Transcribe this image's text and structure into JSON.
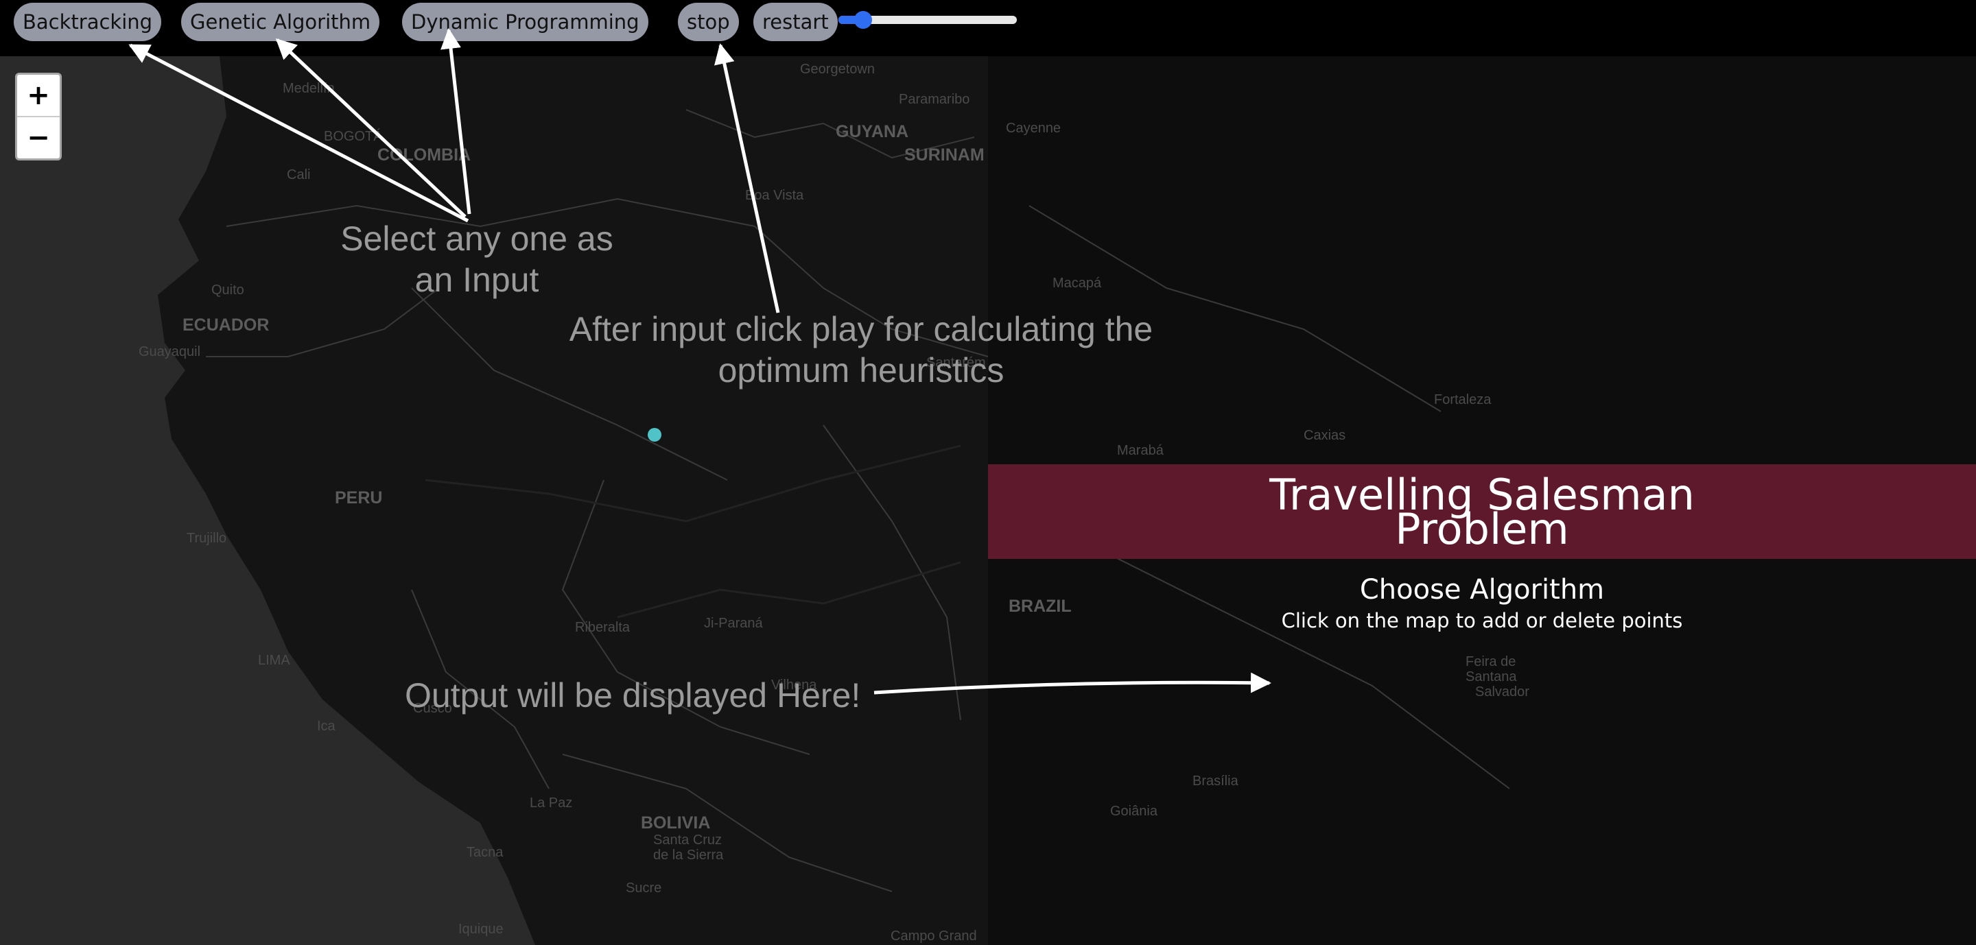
{
  "toolbar": {
    "buttons": {
      "backtracking": "Backtracking",
      "genetic": "Genetic Algorithm",
      "dynamic": "Dynamic Programming",
      "stop": "stop",
      "restart": "restart"
    },
    "speed_slider_fraction": 0.09
  },
  "zoom": {
    "in": "+",
    "out": "−"
  },
  "annotations": {
    "select_line1": "Select any one as",
    "select_line2": "an Input",
    "after_line1": "After input click play for calculating the",
    "after_line2": "optimum heuristics",
    "output": "Output will be displayed Here!"
  },
  "panel": {
    "title_line1": "Travelling Salesman",
    "title_line2": "Problem",
    "subtitle": "Choose Algorithm",
    "hint": "Click on the map to add or delete points",
    "banner_color": "#5e1a2c"
  },
  "map": {
    "countries": {
      "colombia": "COLOMBIA",
      "guyana": "GUYANA",
      "surinam": "SURINAM",
      "ecuador": "ECUADOR",
      "peru": "PERU",
      "brazil": "BRAZIL",
      "bolivia": "BOLIVIA"
    },
    "cities": {
      "medellin": "Medellín",
      "bogota": "BOGOTÁ",
      "cali": "Cali",
      "georgetown": "Georgetown",
      "paramaribo": "Paramaribo",
      "cayenne": "Cayenne",
      "boa_vista": "Boa Vista",
      "quito": "Quito",
      "guayaquil": "Guayaquil",
      "trujillo": "Trujillo",
      "lima": "LIMA",
      "ica": "Ica",
      "cusco": "Cusco",
      "la_paz": "La Paz",
      "santa_cruz": "Santa Cruz",
      "de_la_sierra": "de la Sierra",
      "sucre": "Sucre",
      "tacna": "Tacna",
      "iquique": "Iquique",
      "riberalta": "Riberalta",
      "ji_parana": "Ji-Paraná",
      "vilhena": "Vilhena",
      "campo_grande": "Campo Grand",
      "macapa": "Macapá",
      "santarem": "Santarém",
      "fortaleza": "Fortaleza",
      "caxias": "Caxias",
      "maraba": "Marabá",
      "feira": "Feira de",
      "santana": "Santana",
      "salvador": "Salvador",
      "brasilia": "Brasília",
      "goiania": "Goiânia"
    },
    "point_color": "#4fc3c8"
  }
}
